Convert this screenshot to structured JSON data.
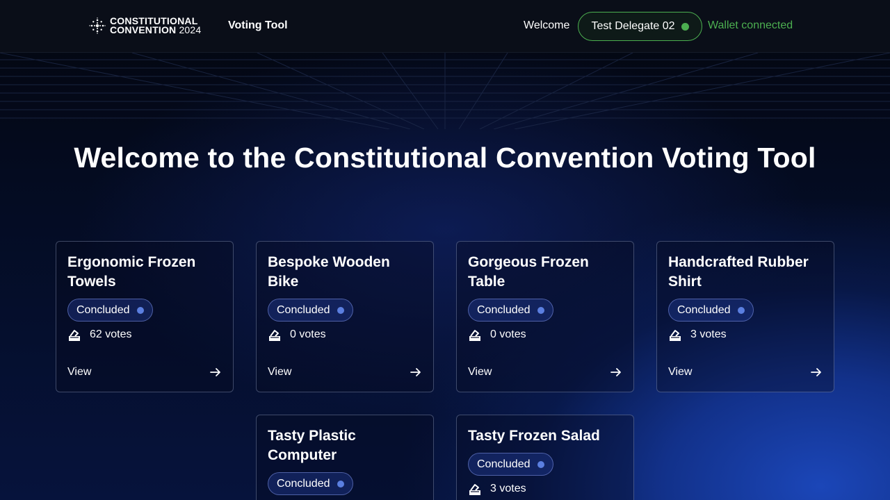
{
  "header": {
    "logo_line1": "CONSTITUTIONAL",
    "logo_line2": "CONVENTION",
    "logo_year": "2024",
    "nav_link": "Voting Tool",
    "welcome_label": "Welcome",
    "delegate_name": "Test Delegate 02",
    "wallet_status": "Wallet connected"
  },
  "main": {
    "title": "Welcome to the Constitutional Convention Voting Tool",
    "view_label": "View",
    "cards": [
      {
        "title": "Ergonomic Frozen Towels",
        "status": "Concluded",
        "votes": "62 votes"
      },
      {
        "title": "Bespoke Wooden Bike",
        "status": "Concluded",
        "votes": "0 votes"
      },
      {
        "title": "Gorgeous Frozen Table",
        "status": "Concluded",
        "votes": "0 votes"
      },
      {
        "title": "Handcrafted Rubber Shirt",
        "status": "Concluded",
        "votes": "3 votes"
      },
      {
        "title": "Tasty Plastic Computer",
        "status": "Concluded",
        "votes": ""
      },
      {
        "title": "Tasty Frozen Salad",
        "status": "Concluded",
        "votes": "3 votes"
      }
    ]
  },
  "colors": {
    "accent_green": "#4caf50",
    "status_dot": "#5b7fe0",
    "background": "#040b20"
  },
  "icons": {
    "logo": "convention-logo-icon",
    "votes": "ballot-box-icon",
    "view": "arrow-right-icon",
    "wallet_status": "status-dot-icon"
  }
}
